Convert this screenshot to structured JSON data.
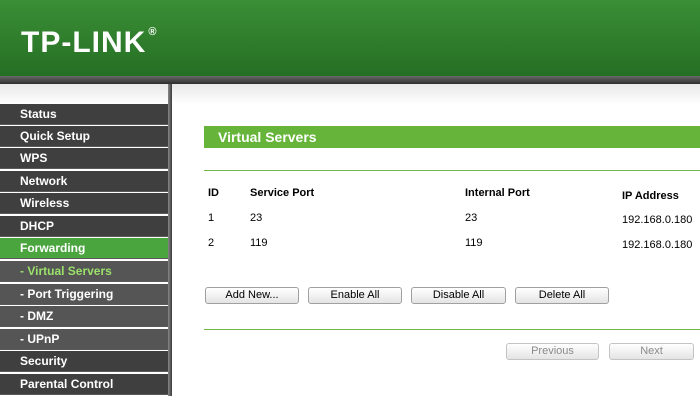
{
  "header": {
    "brand": "TP-LINK",
    "brand_mark": "®"
  },
  "sidebar": {
    "items": [
      {
        "label": "Status"
      },
      {
        "label": "Quick Setup"
      },
      {
        "label": "WPS"
      },
      {
        "label": "Network"
      },
      {
        "label": "Wireless"
      },
      {
        "label": "DHCP"
      },
      {
        "label": "Forwarding"
      },
      {
        "label": "- Virtual Servers"
      },
      {
        "label": "- Port Triggering"
      },
      {
        "label": "- DMZ"
      },
      {
        "label": "- UPnP"
      },
      {
        "label": "Security"
      },
      {
        "label": "Parental Control"
      }
    ]
  },
  "page": {
    "title": "Virtual Servers"
  },
  "table": {
    "headers": [
      "ID",
      "Service Port",
      "Internal Port",
      "IP Address"
    ],
    "rows": [
      [
        "1",
        "23",
        "23",
        "192.168.0.180"
      ],
      [
        "2",
        "119",
        "119",
        "192.168.0.180"
      ]
    ]
  },
  "actions": {
    "add_new": "Add New...",
    "enable_all": "Enable All",
    "disable_all": "Disable All",
    "delete_all": "Delete All"
  },
  "pagination": {
    "previous": "Previous",
    "next": "Next"
  },
  "colors": {
    "brand_green": "#2f7d2c",
    "accent_green": "#66b53a",
    "menu_active": "#4aa53f",
    "menu_dark": "#3f3f3f"
  }
}
